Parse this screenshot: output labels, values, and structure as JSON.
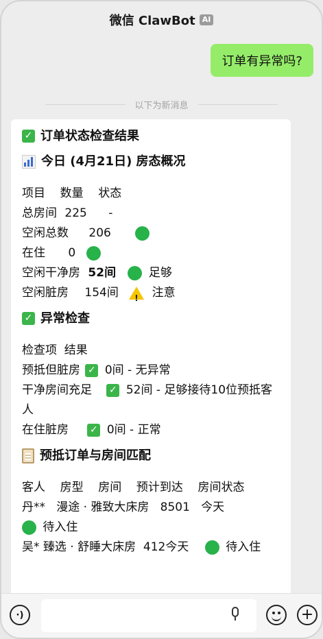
{
  "header": {
    "title": "微信 ClawBot",
    "badge": "AI"
  },
  "user_message": "订单有异常吗?",
  "divider_text": "以下为新消息",
  "report": {
    "title": "订单状态检查结果",
    "overview": {
      "heading": "今日 (4月21日) 房态概况",
      "columns_line": "项目    数量    状态",
      "rows": [
        {
          "name": "总房间",
          "value": "225",
          "status": "-"
        },
        {
          "name": "空闲总数",
          "value": "206",
          "status": ""
        },
        {
          "name": "在住",
          "value": "0",
          "status": ""
        },
        {
          "name": "空闲干净房",
          "value": "52间",
          "status": "足够"
        },
        {
          "name": "空闲脏房",
          "value": "154间",
          "status": "注意"
        }
      ]
    },
    "anomaly": {
      "heading": "异常检查",
      "columns_line": "检查项  结果",
      "rows": [
        {
          "name": "预抵但脏房",
          "result": "0间 - 无异常"
        },
        {
          "name": "干净房间充足",
          "result": "52间 - 足够接待10位预抵客人"
        },
        {
          "name": "在住脏房",
          "result": "0间 - 正常"
        }
      ]
    },
    "match": {
      "heading": "预抵订单与房间匹配",
      "columns_line": "客人    房型    房间    预计到达    房间状态",
      "rows": [
        {
          "text": "丹**   漫途 · 雅致大床房   8501   今天",
          "status": "待入住"
        },
        {
          "text": "吴* 臻选 · 舒睡大床房  412今天",
          "status": "待入住"
        }
      ]
    }
  },
  "input": {
    "placeholder": ""
  },
  "icons": {
    "check": "check-mark-icon",
    "chart": "bar-chart-icon",
    "clipboard": "clipboard-icon",
    "status_ok": "green-circle-icon",
    "status_warn": "warning-icon"
  },
  "colors": {
    "user_bubble": "#95ec69",
    "status_green": "#27b24a",
    "check_green": "#3bb54a",
    "warning": "#f5c500"
  }
}
